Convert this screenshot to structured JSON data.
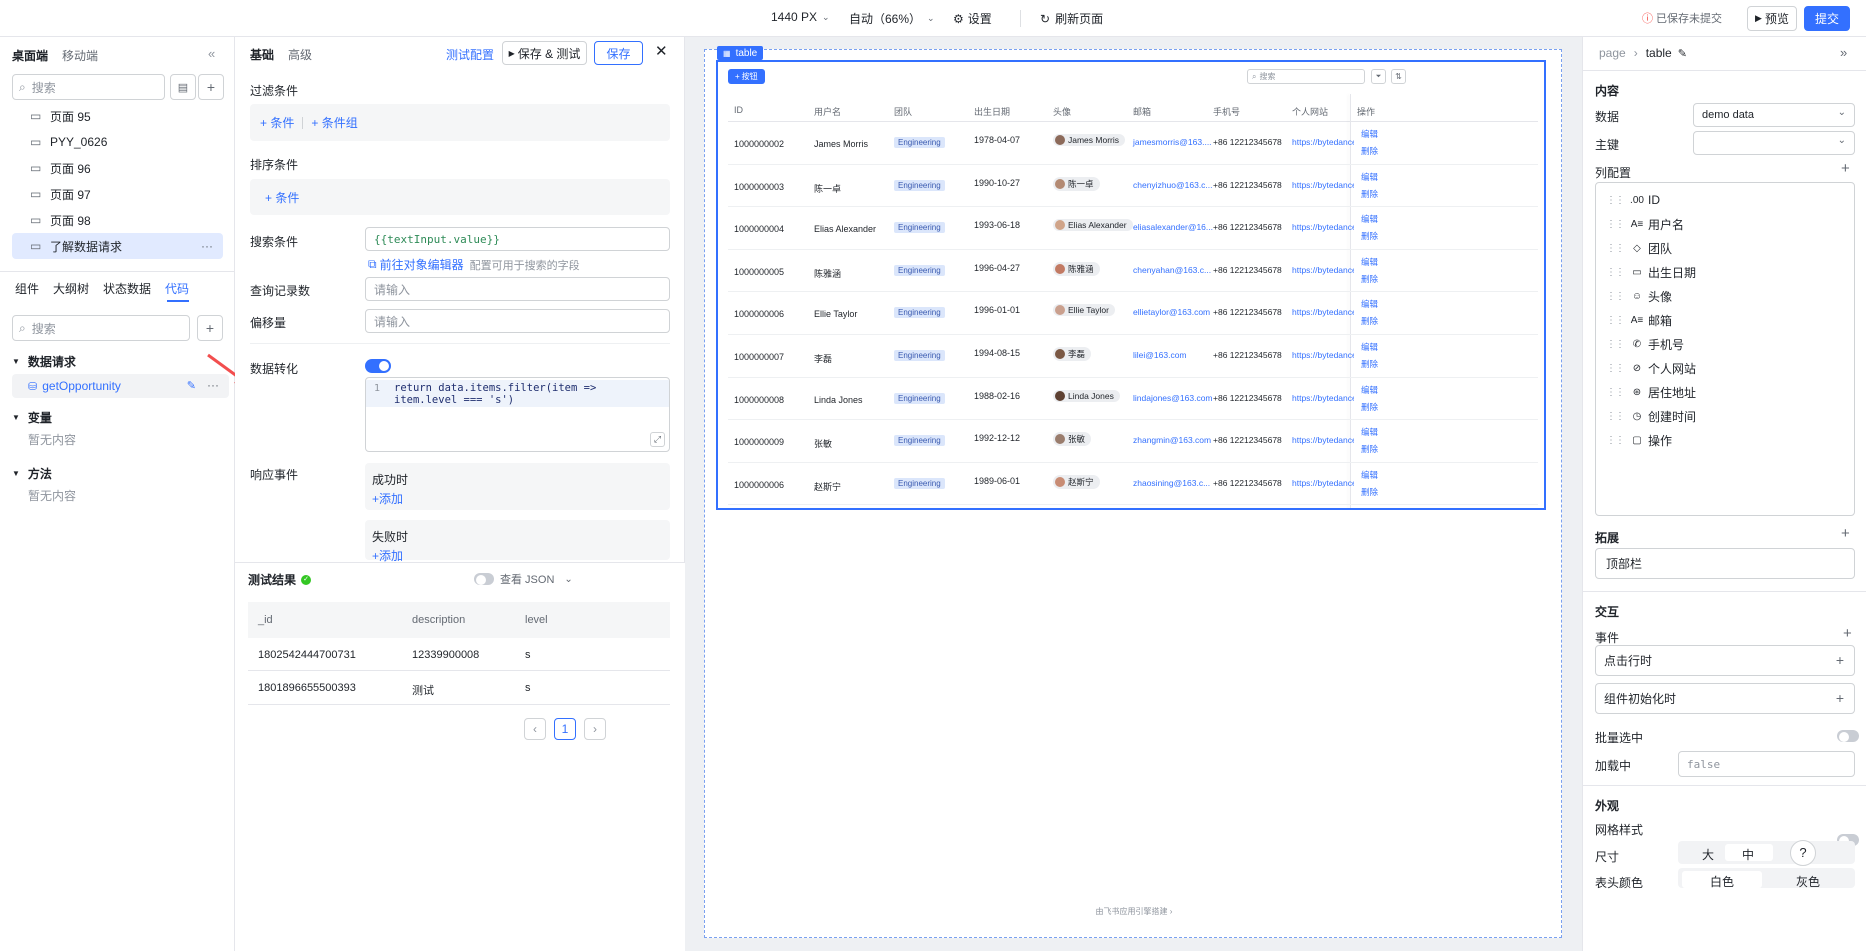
{
  "topbar": {
    "width_label": "1440 PX",
    "zoom_label": "自动（66%）",
    "settings_label": "设置",
    "refresh_label": "刷新页面",
    "unsaved_label": "已保存未提交",
    "preview_label": "预览",
    "submit_label": "提交"
  },
  "left": {
    "tabs": [
      "桌面端",
      "移动端"
    ],
    "search_placeholder": "搜索",
    "pages": [
      "页面 95",
      "PYY_0626",
      "页面 96",
      "页面 97",
      "页面 98",
      "了解数据请求"
    ],
    "bottom_tabs": [
      "组件",
      "大纲树",
      "状态数据",
      "代码"
    ],
    "search2_placeholder": "搜索",
    "groups": {
      "requests": "数据请求",
      "request_item": "getOpportunity",
      "variables": "变量",
      "variables_empty": "暂无内容",
      "methods": "方法",
      "methods_empty": "暂无内容"
    }
  },
  "mid": {
    "tabs": [
      "基础",
      "高级"
    ],
    "test_config": "测试配置",
    "save_test": "保存 & 测试",
    "save": "保存",
    "filter_label": "过滤条件",
    "add_condition": "条件",
    "add_condition_group": "条件组",
    "sort_label": "排序条件",
    "sort_add": "条件",
    "search_label": "搜索条件",
    "search_value": "{{textInput.value}}",
    "object_editor_link": "前往对象编辑器",
    "object_editor_hint": "配置可用于搜索的字段",
    "count_label": "查询记录数",
    "count_placeholder": "请输入",
    "offset_label": "偏移量",
    "offset_placeholder": "请输入",
    "transform_label": "数据转化",
    "code_line_no": "1",
    "code_line1": "return data.items.filter(item =>",
    "code_line2": "item.level === 's')",
    "events_label": "响应事件",
    "on_success": "成功时",
    "on_fail": "失败时",
    "add": "添加",
    "test_result": "测试结果",
    "view_json": "查看 JSON",
    "result_columns": [
      "_id",
      "description",
      "level"
    ],
    "result_rows": [
      [
        "1802542444700731",
        "12339900008",
        "s"
      ],
      [
        "1801896655500393",
        "测试",
        "s"
      ]
    ],
    "page_num": "1"
  },
  "canvas": {
    "table_tag": "table",
    "add_button": "按钮",
    "search_placeholder": "搜索",
    "columns": [
      "ID",
      "用户名",
      "团队",
      "出生日期",
      "头像",
      "邮箱",
      "手机号",
      "个人网站",
      "操作"
    ],
    "rows": [
      {
        "id": "1000000002",
        "name": "James Morris",
        "team": "Engineering",
        "birth": "1978-04-07",
        "avatar": "James Morris",
        "email": "jamesmorris@163....",
        "phone": "+86 12212345678",
        "site": "https://bytedance."
      },
      {
        "id": "1000000003",
        "name": "陈一卓",
        "team": "Engineering",
        "birth": "1990-10-27",
        "avatar": "陈一卓",
        "email": "chenyizhuo@163.c...",
        "phone": "+86 12212345678",
        "site": "https://bytedance."
      },
      {
        "id": "1000000004",
        "name": "Elias Alexander",
        "team": "Engineering",
        "birth": "1993-06-18",
        "avatar": "Elias Alexander",
        "email": "eliasalexander@16...",
        "phone": "+86 12212345678",
        "site": "https://bytedance."
      },
      {
        "id": "1000000005",
        "name": "陈雅涵",
        "team": "Engineering",
        "birth": "1996-04-27",
        "avatar": "陈雅涵",
        "email": "chenyahan@163.c...",
        "phone": "+86 12212345678",
        "site": "https://bytedance."
      },
      {
        "id": "1000000006",
        "name": "Ellie Taylor",
        "team": "Engineering",
        "birth": "1996-01-01",
        "avatar": "Ellie Taylor",
        "email": "ellietaylor@163.com",
        "phone": "+86 12212345678",
        "site": "https://bytedance."
      },
      {
        "id": "1000000007",
        "name": "李磊",
        "team": "Engineering",
        "birth": "1994-08-15",
        "avatar": "李磊",
        "email": "lilei@163.com",
        "phone": "+86 12212345678",
        "site": "https://bytedance."
      },
      {
        "id": "1000000008",
        "name": "Linda Jones",
        "team": "Engineering",
        "birth": "1988-02-16",
        "avatar": "Linda Jones",
        "email": "lindajones@163.com",
        "phone": "+86 12212345678",
        "site": "https://bytedance."
      },
      {
        "id": "1000000009",
        "name": "张敏",
        "team": "Engineering",
        "birth": "1992-12-12",
        "avatar": "张敏",
        "email": "zhangmin@163.com",
        "phone": "+86 12212345678",
        "site": "https://bytedance."
      },
      {
        "id": "1000000006",
        "name": "赵斯宁",
        "team": "Engineering",
        "birth": "1989-06-01",
        "avatar": "赵斯宁",
        "email": "zhaosining@163.c...",
        "phone": "+86 12212345678",
        "site": "https://bytedance."
      }
    ],
    "edit": "编辑",
    "delete": "删除",
    "footer": "由飞书应用引擎搭建 ›"
  },
  "right": {
    "breadcrumb_page": "page",
    "breadcrumb_current": "table",
    "content_title": "内容",
    "data_label": "数据",
    "data_value": "demo data",
    "key_label": "主键",
    "columns_label": "列配置",
    "columns": [
      {
        "icon": ".00",
        "label": "ID"
      },
      {
        "icon": "A≡",
        "label": "用户名"
      },
      {
        "icon": "◇",
        "label": "团队"
      },
      {
        "icon": "▭",
        "label": "出生日期"
      },
      {
        "icon": "☺",
        "label": "头像"
      },
      {
        "icon": "A≡",
        "label": "邮箱"
      },
      {
        "icon": "✆",
        "label": "手机号"
      },
      {
        "icon": "⊘",
        "label": "个人网站"
      },
      {
        "icon": "⊛",
        "label": "居住地址"
      },
      {
        "icon": "◷",
        "label": "创建时间"
      },
      {
        "icon": "▢",
        "label": "操作"
      }
    ],
    "extend_label": "拓展",
    "extend_item": "顶部栏",
    "interaction_title": "交互",
    "events_label": "事件",
    "event_row_click": "点击行时",
    "event_init": "组件初始化时",
    "batch_label": "批量选中",
    "loading_label": "加载中",
    "loading_value": "false",
    "appearance_title": "外观",
    "grid_label": "网格样式",
    "size_label": "尺寸",
    "size_options": [
      "大",
      "中"
    ],
    "header_color_label": "表头颜色",
    "header_color_options": [
      "白色",
      "灰色"
    ]
  },
  "colors": {
    "accent": "#3370ff",
    "canvas_bg": "#eef0f3",
    "tag_bg": "#dbe6fb",
    "arrow": "#f24e4e"
  }
}
